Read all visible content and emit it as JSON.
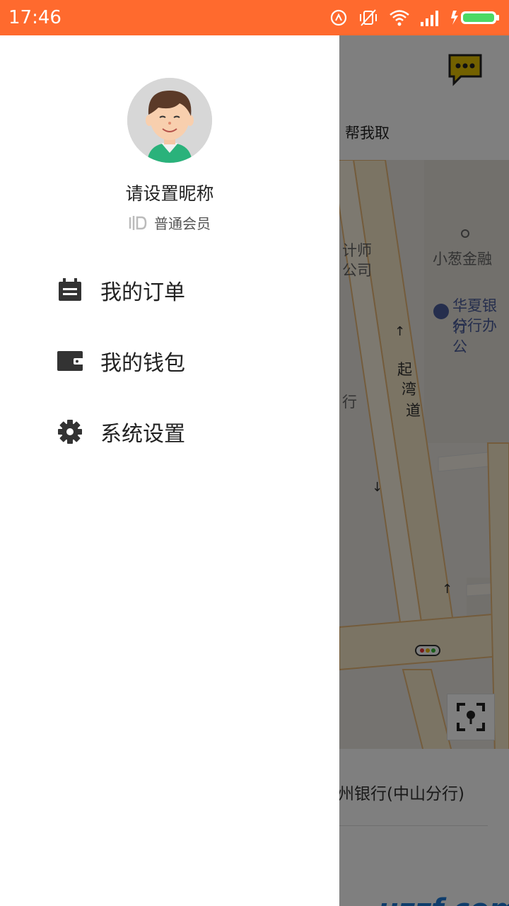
{
  "status_bar": {
    "time": "17:46"
  },
  "background": {
    "tab_label": "帮我取",
    "map_labels": [
      "计师",
      "公司",
      "小葱金融",
      "华夏银行",
      "分行办公",
      "起",
      "湾",
      "道",
      "行"
    ],
    "bottom_address": "州银行(中山分行)",
    "watermark": "uzzf.com"
  },
  "drawer": {
    "nickname": "请设置昵称",
    "member_level": "普通会员",
    "menu": [
      {
        "label": "我的订单",
        "icon": "calendar-icon"
      },
      {
        "label": "我的钱包",
        "icon": "wallet-icon"
      },
      {
        "label": "系统设置",
        "icon": "gear-icon"
      }
    ]
  },
  "colors": {
    "status_bar": "#ff6a2e",
    "map_road": "#f2c48a",
    "chat_icon": "#d8b400"
  }
}
